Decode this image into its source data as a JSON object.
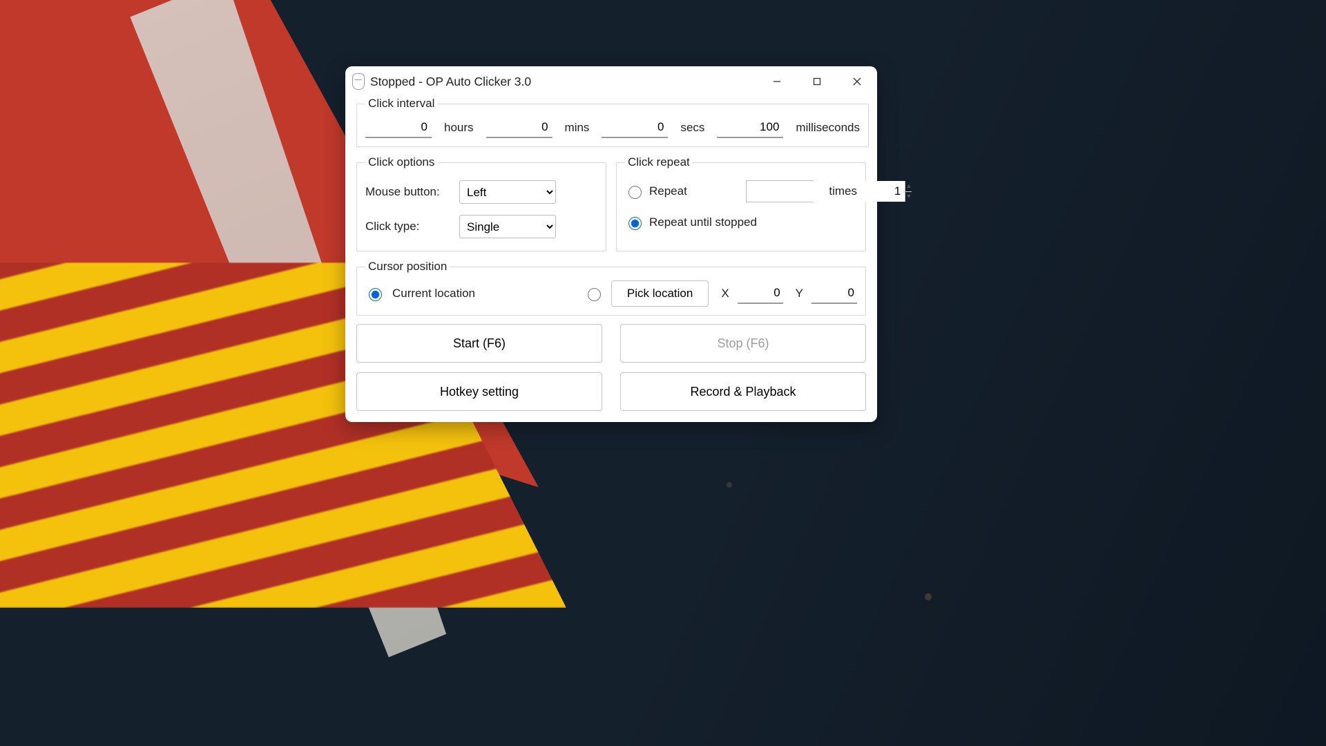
{
  "window": {
    "title": "Stopped - OP Auto Clicker 3.0"
  },
  "click_interval": {
    "legend": "Click interval",
    "hours": {
      "value": "0",
      "unit": "hours"
    },
    "mins": {
      "value": "0",
      "unit": "mins"
    },
    "secs": {
      "value": "0",
      "unit": "secs"
    },
    "ms": {
      "value": "100",
      "unit": "milliseconds"
    }
  },
  "click_options": {
    "legend": "Click options",
    "mouse_button_label": "Mouse button:",
    "mouse_button_value": "Left",
    "click_type_label": "Click type:",
    "click_type_value": "Single"
  },
  "click_repeat": {
    "legend": "Click repeat",
    "repeat_label": "Repeat",
    "repeat_value": "1",
    "times_label": "times",
    "repeat_until_label": "Repeat until stopped"
  },
  "cursor_position": {
    "legend": "Cursor position",
    "current_label": "Current location",
    "pick_button": "Pick location",
    "x_label": "X",
    "x_value": "0",
    "y_label": "Y",
    "y_value": "0"
  },
  "buttons": {
    "start": "Start (F6)",
    "stop": "Stop (F6)",
    "hotkey": "Hotkey setting",
    "record": "Record & Playback"
  }
}
